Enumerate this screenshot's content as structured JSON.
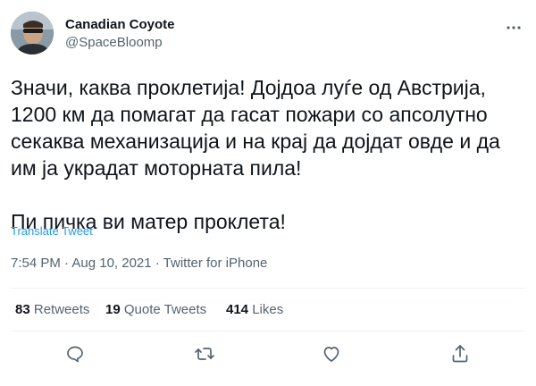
{
  "author": {
    "name": "Canadian Coyote",
    "handle": "@SpaceBloomp"
  },
  "tweet": {
    "text": "Значи, каква проклетија! Дојдоа луѓе  од Австрија,\n1200 км да помагат да гасат пожари со апсолутно\nсекаква механизација и на крај да дојдат овде и да\nим ја украдат моторната пила!\n\nПи пичка ви матер проклета!",
    "translate_label": "Translate Tweet",
    "meta": "7:54 PM · Aug 10, 2021 · Twitter for iPhone"
  },
  "stats": {
    "retweets_count": "83",
    "retweets_label": "Retweets",
    "quotes_count": "19",
    "quotes_label": "Quote Tweets",
    "likes_count": "414",
    "likes_label": "Likes"
  },
  "icons": {
    "more": "more-horizontal-icon",
    "reply": "reply-icon",
    "retweet": "retweet-icon",
    "like": "like-icon",
    "share": "share-icon"
  },
  "colors": {
    "accent": "#1d9bf0",
    "text": "#0f1419",
    "secondary": "#536471",
    "divider": "#eff3f4"
  }
}
